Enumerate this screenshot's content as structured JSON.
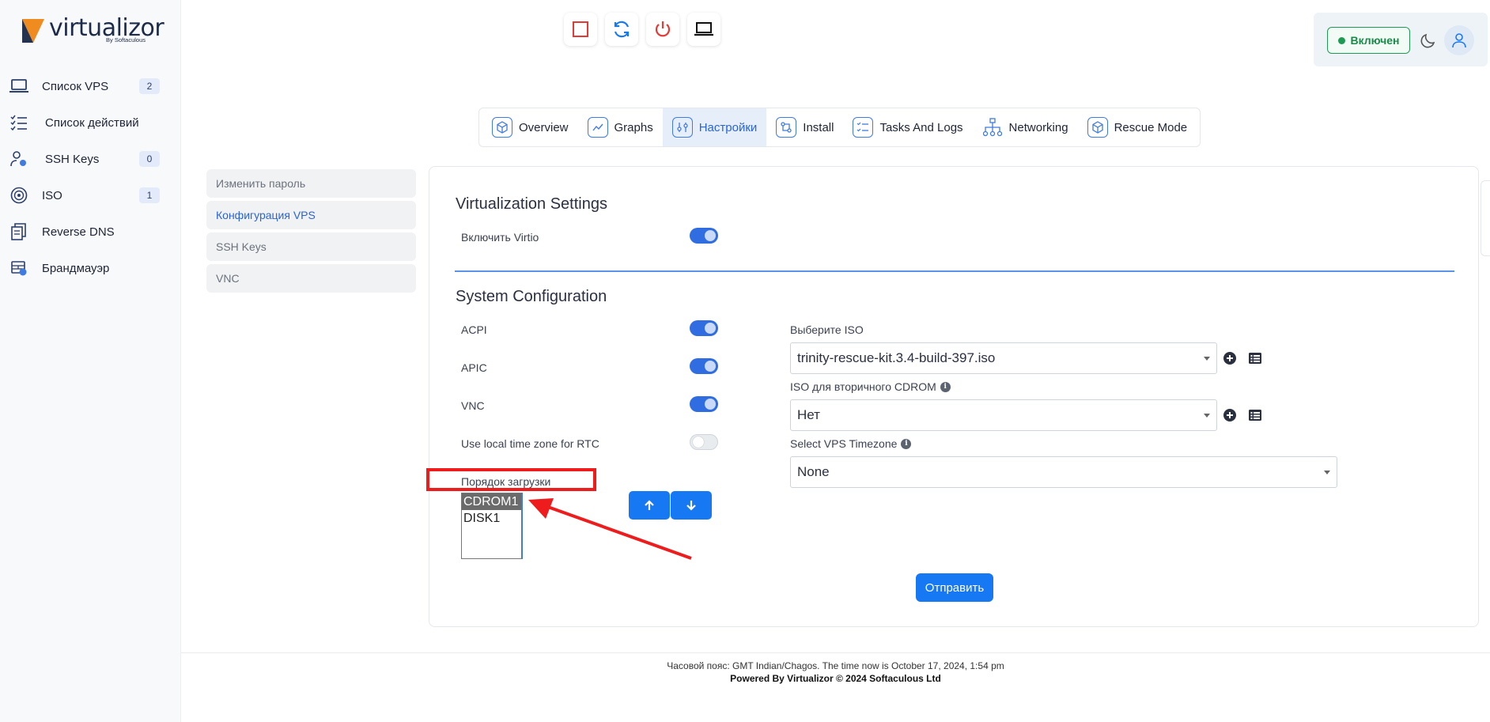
{
  "brand": {
    "name": "virtualizor",
    "sub": "By Softaculous"
  },
  "sidebar": {
    "items": [
      {
        "label": "Список VPS",
        "icon": "laptop-icon",
        "badge": "2"
      },
      {
        "label": "Список действий",
        "icon": "checklist-icon",
        "badge": ""
      },
      {
        "label": "SSH Keys",
        "icon": "user-key-icon",
        "badge": "0"
      },
      {
        "label": "ISO",
        "icon": "disc-icon",
        "badge": "1"
      },
      {
        "label": "Reverse DNS",
        "icon": "document-stack-icon",
        "badge": ""
      },
      {
        "label": "Брандмауэр",
        "icon": "firewall-icon",
        "badge": ""
      }
    ]
  },
  "toolbar": {
    "buttons": [
      "stop-icon",
      "restart-icon",
      "power-icon",
      "console-icon"
    ]
  },
  "header": {
    "status": "Включен"
  },
  "tabs": [
    {
      "label": "Overview",
      "icon": "cube-icon"
    },
    {
      "label": "Graphs",
      "icon": "graph-icon"
    },
    {
      "label": "Настройки",
      "icon": "sliders-icon"
    },
    {
      "label": "Install",
      "icon": "install-icon"
    },
    {
      "label": "Tasks And Logs",
      "icon": "tasks-icon"
    },
    {
      "label": "Networking",
      "icon": "network-icon"
    },
    {
      "label": "Rescue Mode",
      "icon": "rescue-box-icon"
    }
  ],
  "submenu": [
    {
      "label": "Изменить пароль"
    },
    {
      "label": "Конфигурация VPS"
    },
    {
      "label": "SSH Keys"
    },
    {
      "label": "VNC"
    }
  ],
  "virtualization": {
    "title": "Virtualization Settings",
    "virtio_label": "Включить Virtio",
    "virtio_on": true
  },
  "system": {
    "title": "System Configuration",
    "toggles": [
      {
        "label": "ACPI",
        "on": true
      },
      {
        "label": "APIC",
        "on": true
      },
      {
        "label": "VNC",
        "on": true
      },
      {
        "label": "Use local time zone for RTC",
        "on": false
      }
    ],
    "boot_order_label": "Порядок загрузки",
    "boot_order": [
      "CDROM1",
      "DISK1"
    ],
    "iso_label": "Выберите ISO",
    "iso_value": "trinity-rescue-kit.3.4-build-397.iso",
    "iso2_label": "ISO для вторичного CDROM",
    "iso2_value": "Нет",
    "tz_label": "Select VPS Timezone",
    "tz_value": "None",
    "submit_label": "Отправить"
  },
  "footer": {
    "line1": "Часовой пояс: GMT Indian/Chagos. The time now is October 17, 2024, 1:54 pm",
    "line2": "Powered By Virtualizor © 2024 Softaculous Ltd"
  },
  "colors": {
    "accent": "#1678f2",
    "active_tab": "#2a64d6",
    "status_green": "#1e9b52",
    "annotation_red": "#ee1c1c"
  }
}
